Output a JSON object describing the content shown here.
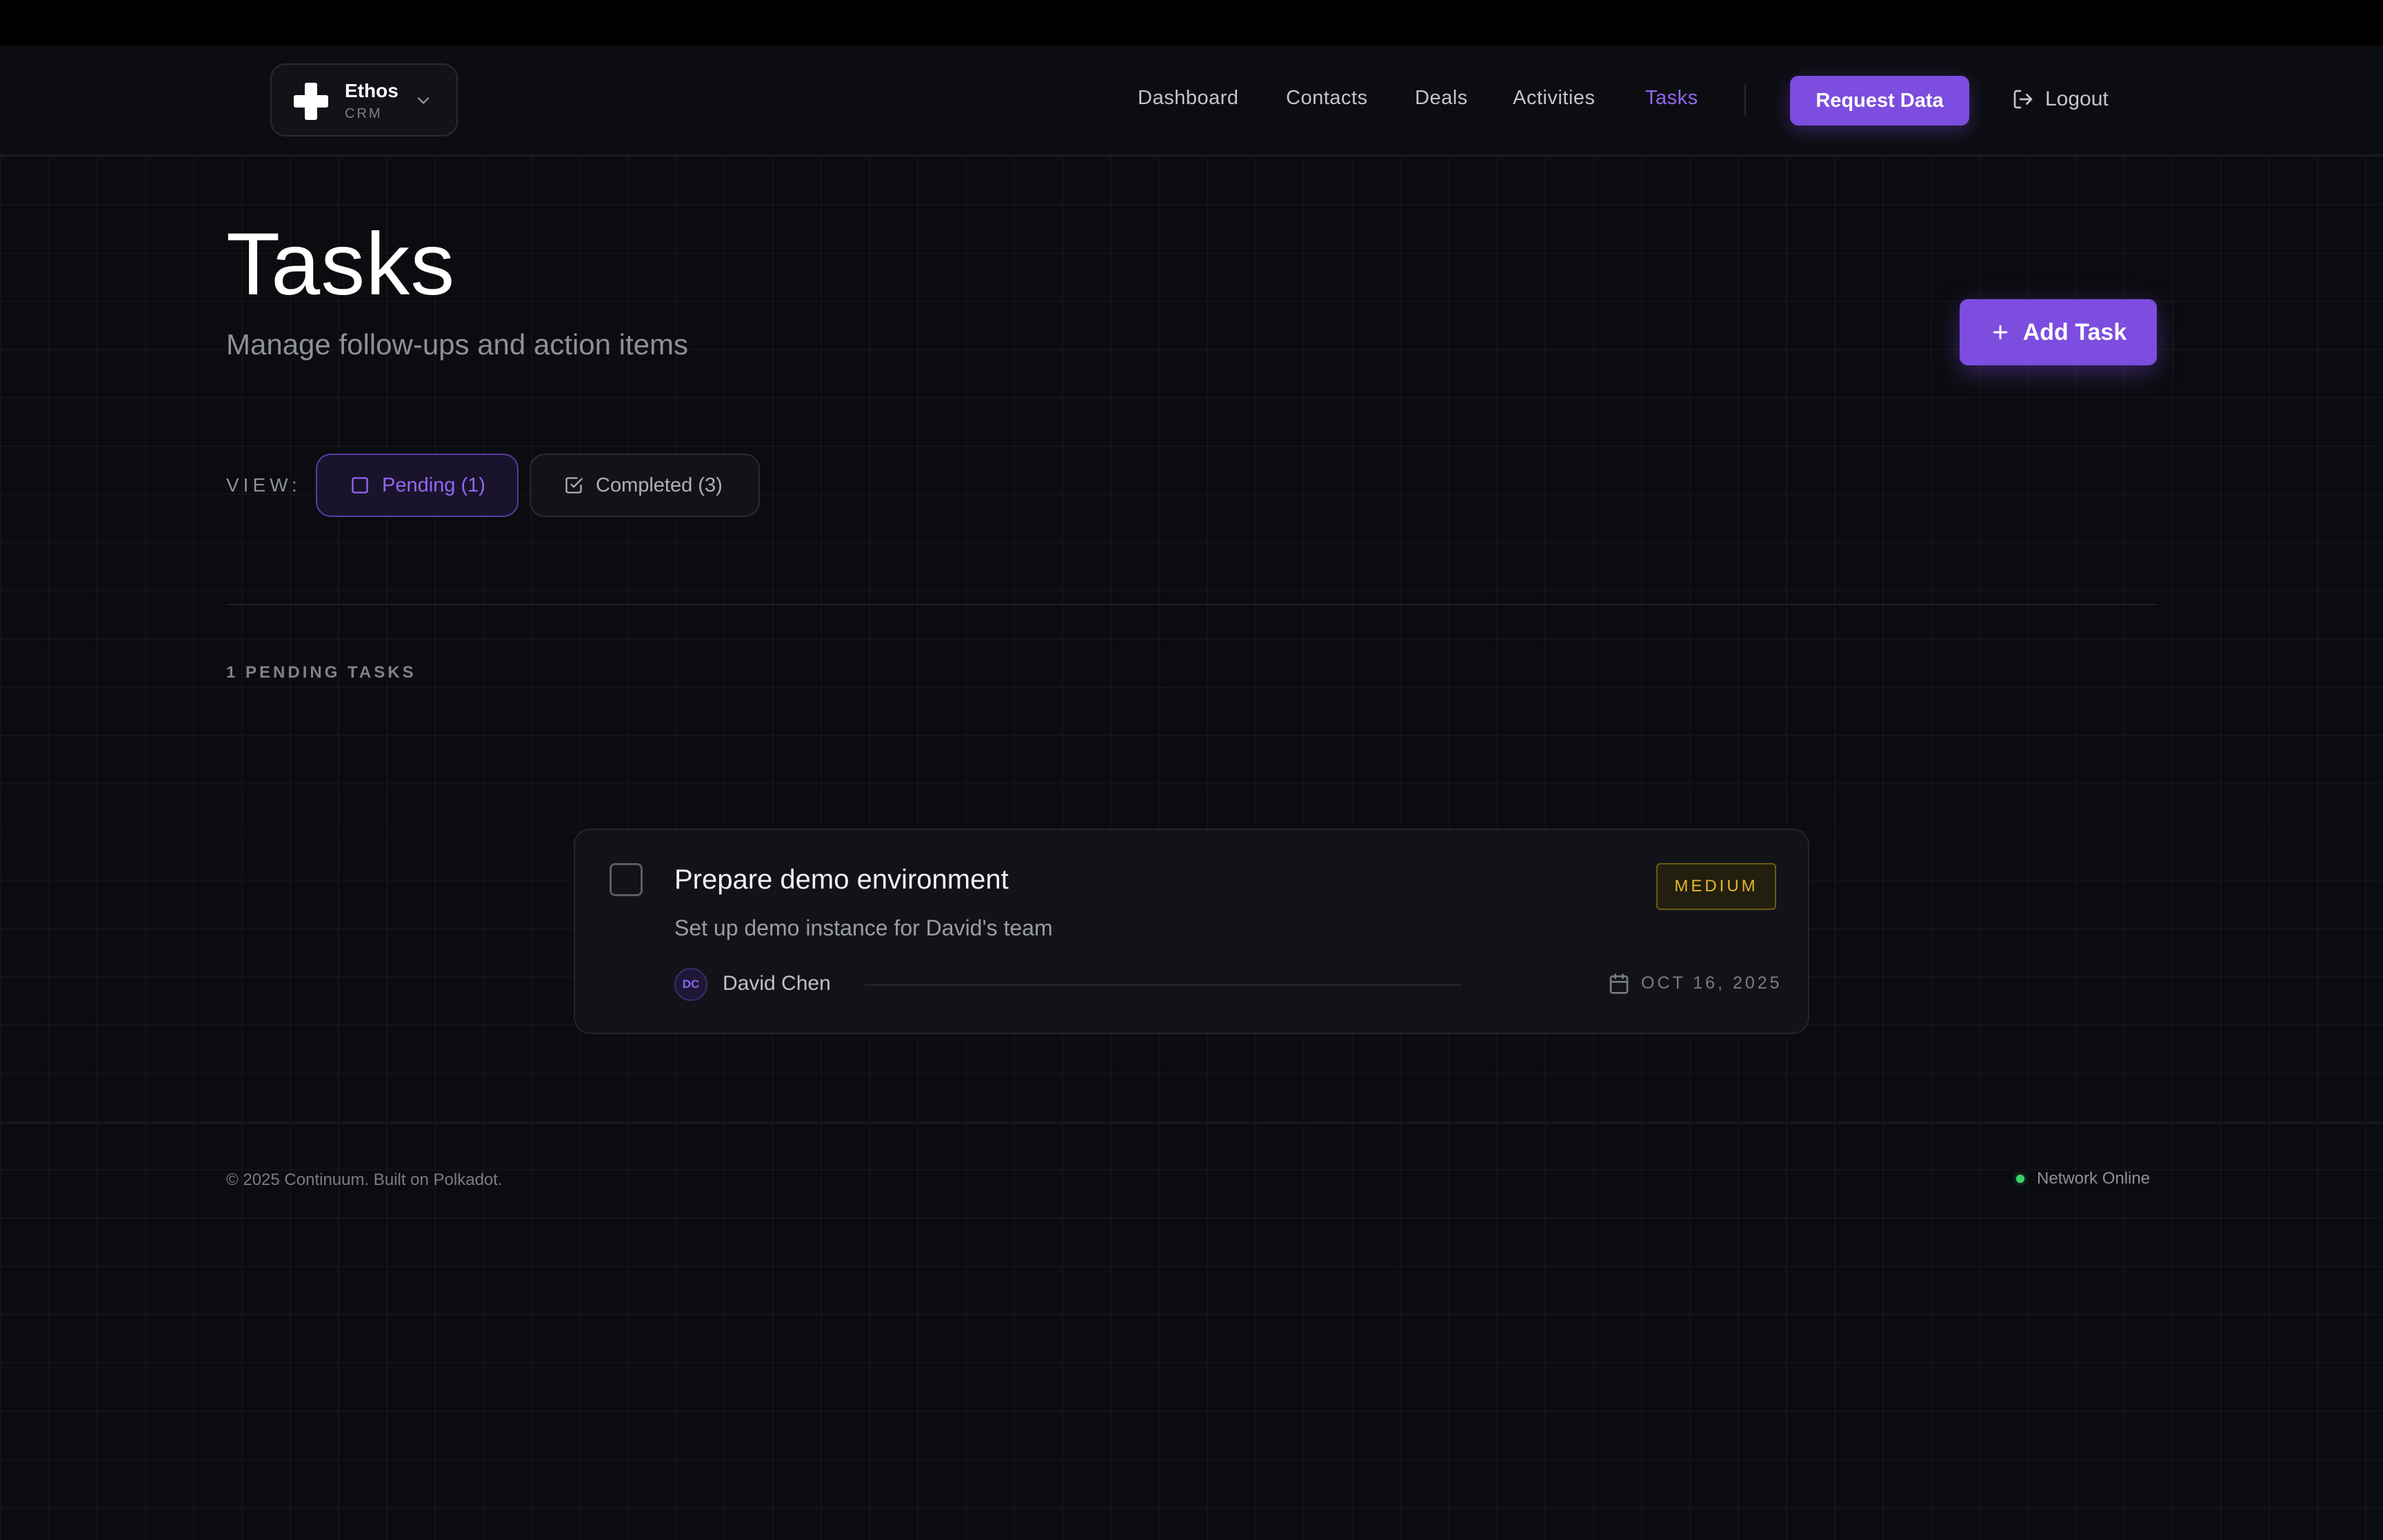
{
  "brand": {
    "name": "Ethos",
    "sub": "CRM"
  },
  "nav": {
    "items": [
      {
        "label": "Dashboard",
        "active": false
      },
      {
        "label": "Contacts",
        "active": false
      },
      {
        "label": "Deals",
        "active": false
      },
      {
        "label": "Activities",
        "active": false
      },
      {
        "label": "Tasks",
        "active": true
      }
    ],
    "request_label": "Request Data",
    "logout_label": "Logout"
  },
  "page": {
    "title": "Tasks",
    "subtitle": "Manage follow-ups and action items",
    "add_label": "Add Task"
  },
  "view": {
    "label": "VIEW:",
    "tabs": [
      {
        "label": "Pending (1)",
        "active": true
      },
      {
        "label": "Completed (3)",
        "active": false
      }
    ]
  },
  "list": {
    "count_label": "1 PENDING TASKS",
    "tasks": [
      {
        "title": "Prepare demo environment",
        "description": "Set up demo instance for David's team",
        "priority": "MEDIUM",
        "assignee_initials": "DC",
        "assignee": "David Chen",
        "due": "OCT 16, 2025",
        "completed": false
      }
    ]
  },
  "footer": {
    "copyright": "© 2025 Continuum. Built on Polkadot.",
    "status": "Network Online"
  },
  "colors": {
    "accent": "#7c4ddf",
    "background": "#0b0c0f",
    "priority_medium": "#e3b92c",
    "status_online": "#3ed36a"
  }
}
